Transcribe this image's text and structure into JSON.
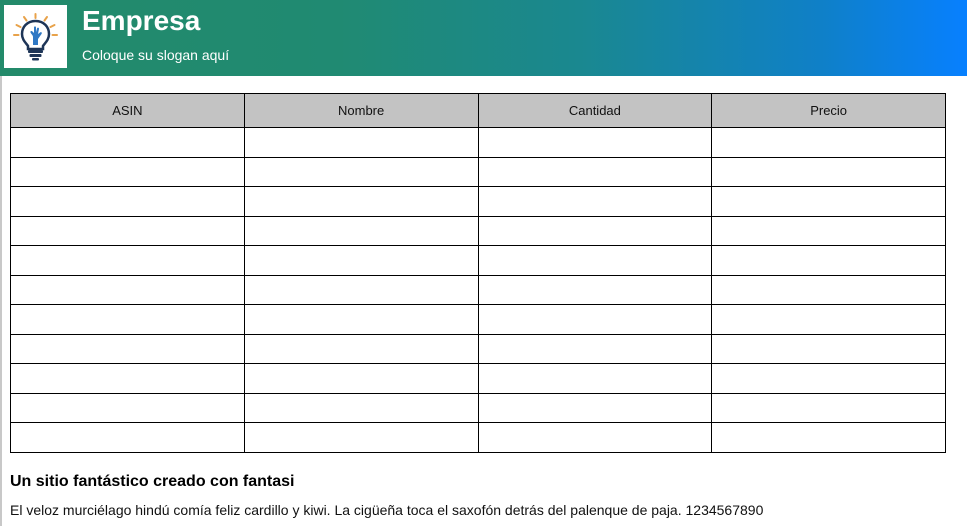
{
  "header": {
    "company": "Empresa",
    "slogan": "Coloque su slogan aquí",
    "logo_icon": "lightbulb-hand-icon",
    "gradient_start": "#238a6a",
    "gradient_end": "#0780ff"
  },
  "table": {
    "columns": [
      "ASIN",
      "Nombre",
      "Cantidad",
      "Precio"
    ],
    "rows": [
      [
        "",
        "",
        "",
        ""
      ],
      [
        "",
        "",
        "",
        ""
      ],
      [
        "",
        "",
        "",
        ""
      ],
      [
        "",
        "",
        "",
        ""
      ],
      [
        "",
        "",
        "",
        ""
      ],
      [
        "",
        "",
        "",
        ""
      ],
      [
        "",
        "",
        "",
        ""
      ],
      [
        "",
        "",
        "",
        ""
      ],
      [
        "",
        "",
        "",
        ""
      ],
      [
        "",
        "",
        "",
        ""
      ],
      [
        "",
        "",
        "",
        ""
      ]
    ],
    "header_bg": "#c3c3c3"
  },
  "footer": {
    "title": "Un sitio fantástico creado con fantasi",
    "text": "El veloz murciélago hindú comía feliz cardillo y kiwi. La cigüeña toca el saxofón detrás del palenque de paja. 1234567890"
  }
}
